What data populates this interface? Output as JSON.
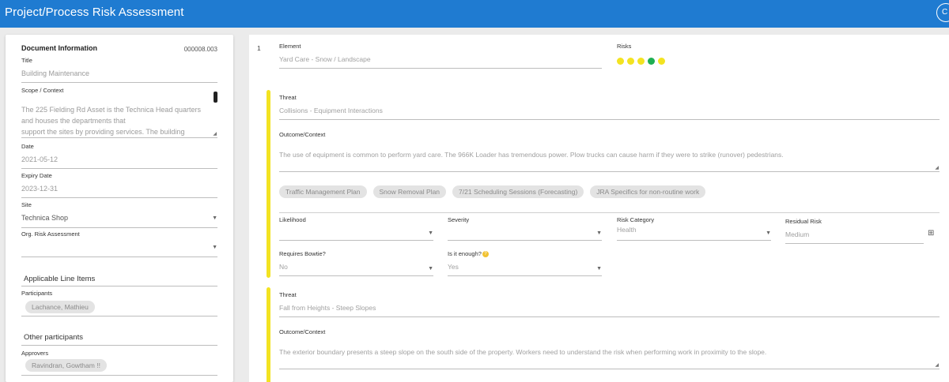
{
  "header": {
    "title": "Project/Process Risk Assessment",
    "action_icon_glyph": "C"
  },
  "doc": {
    "heading": "Document Information",
    "number": "000008.003",
    "title_label": "Title",
    "title_value": "Building Maintenance",
    "scope_label": "Scope / Context",
    "scope_lines": [
      "The 225 Fielding Rd Asset is the Technica Head quarters",
      "and houses the departments that",
      "support the sites by providing services. The building"
    ],
    "date_label": "Date",
    "date_value": "2021-05-12",
    "expiry_label": "Expiry Date",
    "expiry_value": "2023-12-31",
    "site_label": "Site",
    "site_value": "Technica Shop",
    "org_label": "Org. Risk Assessment",
    "org_value": ""
  },
  "line_items": {
    "heading": "Applicable Line Items",
    "participants_label": "Participants",
    "participants": [
      "Lachance, Mathieu"
    ]
  },
  "other": {
    "heading": "Other participants",
    "approvers_label": "Approvers",
    "approvers": [
      "Ravindran, Gowtham !!"
    ]
  },
  "element": {
    "index": "1",
    "label": "Element",
    "value": "Yard Care - Snow / Landscape",
    "risks_label": "Risks",
    "risk_colors": [
      "#f3e321",
      "#f3e321",
      "#f3e321",
      "#1eae53",
      "#f3e321"
    ]
  },
  "threat1": {
    "threat_label": "Threat",
    "threat_value": "Collisions - Equipment Interactions",
    "outcome_label": "Outcome/Context",
    "outcome_value": "The use of equipment is common to perform yard care.  The 966K Loader has tremendous power.  Plow trucks can cause harm if they were to strike (runover) pedestrians.",
    "controls": [
      "Traffic Management Plan",
      "Snow Removal Plan",
      "7/21 Scheduling Sessions (Forecasting)",
      "JRA Specifics for non-routine work"
    ],
    "likelihood_label": "Likelihood",
    "likelihood_value": "",
    "severity_label": "Severity",
    "severity_value": "",
    "category_label": "Risk Category",
    "category_value": "Health",
    "residual_label": "Residual Risk",
    "residual_value": "Medium",
    "bowtie_label": "Requires Bowtie?",
    "bowtie_value": "No",
    "enough_label": "Is it enough?",
    "enough_value": "Yes"
  },
  "threat2": {
    "threat_label": "Threat",
    "threat_value": "Fall from Heights - Steep Slopes",
    "outcome_label": "Outcome/Context",
    "outcome_value": "The exterior boundary presents a steep slope on the south side of the property.  Workers need to understand the risk when performing work in proximity to the slope."
  },
  "colors": {
    "header_bg": "#1f7bd1",
    "threat_bar": "#f3e321",
    "risk_green": "#1eae53"
  }
}
